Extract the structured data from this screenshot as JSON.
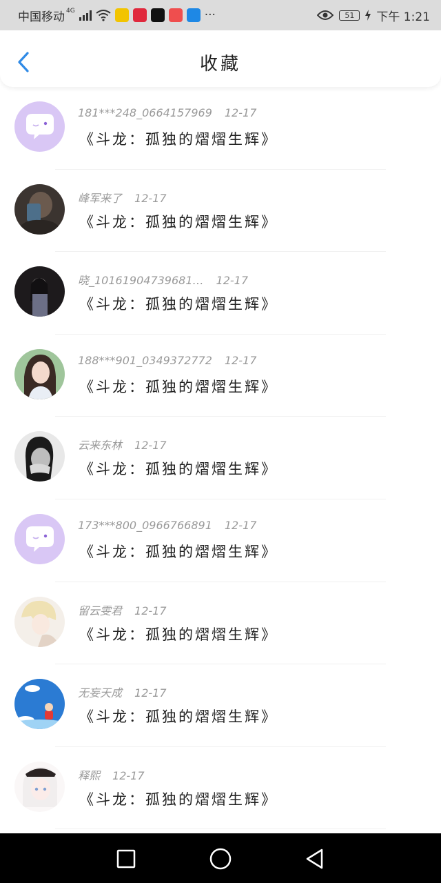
{
  "status_bar": {
    "carrier": "中国移动",
    "network": "4G",
    "battery": "51",
    "time": "下午 1:21",
    "app_badges": [
      {
        "icon": "app-yellow-icon",
        "color": "#f2c400"
      },
      {
        "icon": "app-xiaohongshu-icon",
        "color": "#e0283c"
      },
      {
        "icon": "app-tiktok-icon",
        "color": "#111111"
      },
      {
        "icon": "app-red-icon",
        "color": "#ef4e4e"
      },
      {
        "icon": "app-blue-icon",
        "color": "#1e88e5"
      }
    ],
    "more": "···"
  },
  "header": {
    "title": "收藏"
  },
  "accent_color": "#2f8ae6",
  "favorites": [
    {
      "user": "181***248_0664157969",
      "date": "12-17",
      "book": "《斗龙：孤独的熠熠生辉》",
      "avatar": "default"
    },
    {
      "user": "峰军来了",
      "date": "12-17",
      "book": "《斗龙：孤独的熠熠生辉》",
      "avatar": "dark-selfie"
    },
    {
      "user": "晓_10161904739681…",
      "date": "12-17",
      "book": "《斗龙：孤独的熠熠生辉》",
      "avatar": "night-portrait"
    },
    {
      "user": "188***901_0349372772",
      "date": "12-17",
      "book": "《斗龙：孤独的熠熠生辉》",
      "avatar": "girl-portrait"
    },
    {
      "user": "云来东林",
      "date": "12-17",
      "book": "《斗龙：孤独的熠熠生辉》",
      "avatar": "bw-portrait"
    },
    {
      "user": "173***800_0966766891",
      "date": "12-17",
      "book": "《斗龙：孤独的熠熠生辉》",
      "avatar": "default"
    },
    {
      "user": "留云雯君",
      "date": "12-17",
      "book": "《斗龙：孤独的熠熠生辉》",
      "avatar": "anime-blond"
    },
    {
      "user": "无妄天成",
      "date": "12-17",
      "book": "《斗龙：孤独的熠熠生辉》",
      "avatar": "blue-cartoon"
    },
    {
      "user": "释熙",
      "date": "12-17",
      "book": "《斗龙：孤独的熠熠生辉》",
      "avatar": "anime-white-hair"
    }
  ]
}
